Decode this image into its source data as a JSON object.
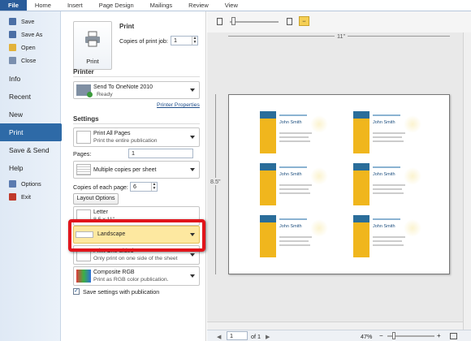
{
  "ribbon": {
    "tabs": [
      "File",
      "Home",
      "Insert",
      "Page Design",
      "Mailings",
      "Review",
      "View"
    ]
  },
  "nav": {
    "commands_top": [
      {
        "label": "Save",
        "icon": "save-icon",
        "color": "#4b6fa5"
      },
      {
        "label": "Save As",
        "icon": "save-as-icon",
        "color": "#4b6fa5"
      },
      {
        "label": "Open",
        "icon": "open-folder-icon",
        "color": "#e2b23a"
      },
      {
        "label": "Close",
        "icon": "close-file-icon",
        "color": "#7a8fae"
      }
    ],
    "sections": [
      "Info",
      "Recent",
      "New",
      "Print",
      "Save & Send",
      "Help"
    ],
    "active": "Print",
    "commands_bottom": [
      {
        "label": "Options",
        "icon": "options-icon",
        "color": "#5b7bb0"
      },
      {
        "label": "Exit",
        "icon": "exit-icon",
        "color": "#c0392b"
      }
    ]
  },
  "print": {
    "heading": "Print",
    "button_label": "Print",
    "copies_label": "Copies of print job:",
    "copies_value": "1"
  },
  "printer": {
    "heading": "Printer",
    "name": "Send To OneNote 2010",
    "status": "Ready",
    "properties_link": "Printer Properties"
  },
  "settings": {
    "heading": "Settings",
    "pages_dropdown": {
      "title": "Print All Pages",
      "subtitle": "Print the entire publication"
    },
    "pages_label": "Pages:",
    "pages_value": "1",
    "layout_dropdown": {
      "title": "Multiple copies per sheet"
    },
    "copies_each_label": "Copies of each page:",
    "copies_each_value": "6",
    "layout_options_button": "Layout Options",
    "paper_dropdown": {
      "title": "Letter",
      "subtitle": "8.5 x 11\""
    },
    "orientation_dropdown": {
      "title": "Landscape"
    },
    "sides_dropdown": {
      "title": "Print One Sided",
      "subtitle": "Only print on one side of the sheet"
    },
    "color_dropdown": {
      "title": "Composite RGB",
      "subtitle": "Print as RGB color publication."
    },
    "save_settings_label": "Save settings with publication",
    "save_settings_checked": true
  },
  "preview": {
    "ruler_width": "11\"",
    "ruler_height": "8.5\"",
    "card_name": "John Smith",
    "page_current": "1",
    "page_total": "of 1",
    "zoom": "47%",
    "card_colors": {
      "blue": "#2a6d9a",
      "yellow": "#f0b61d"
    }
  },
  "highlight_color": "#e1141b"
}
